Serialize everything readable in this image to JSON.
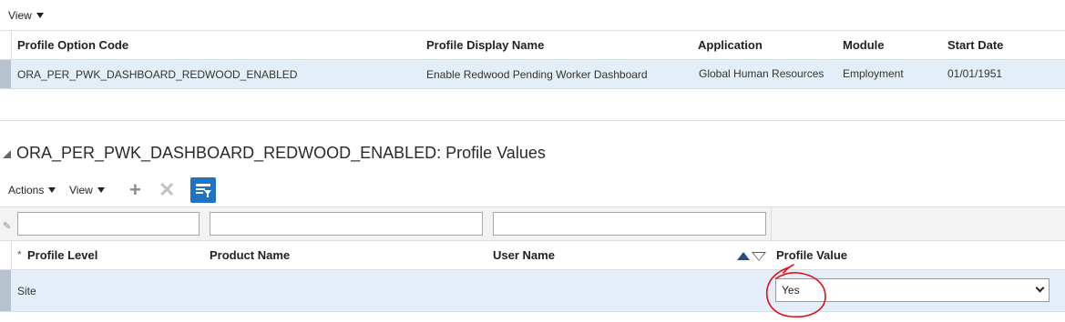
{
  "toolbar_top": {
    "view_label": "View"
  },
  "profile_options_table": {
    "columns": [
      "Profile Option Code",
      "Profile Display Name",
      "Application",
      "Module",
      "Start Date"
    ],
    "row": {
      "code": "ORA_PER_PWK_DASHBOARD_REDWOOD_ENABLED",
      "display_name": "Enable Redwood Pending Worker Dashboard",
      "application": "Global Human Resources",
      "module": "Employment",
      "start_date": "01/01/1951"
    }
  },
  "profile_values_section": {
    "title": "ORA_PER_PWK_DASHBOARD_REDWOOD_ENABLED: Profile Values",
    "toolbar": {
      "actions_label": "Actions",
      "view_label": "View",
      "add_icon": "plus-icon",
      "delete_icon": "close-icon",
      "filter_icon": "query-by-example-icon"
    },
    "filter_inputs": [
      {
        "value": ""
      },
      {
        "value": ""
      },
      {
        "value": ""
      }
    ],
    "columns": {
      "required_marker": "*",
      "profile_level": "Profile Level",
      "product_name": "Product Name",
      "user_name": "User Name",
      "profile_value": "Profile Value"
    },
    "row": {
      "profile_level": "Site",
      "product_name": "",
      "user_name": "",
      "profile_value": "Yes"
    }
  },
  "colors": {
    "selected_row": "#e4eef9",
    "accent_blue": "#1f73c2",
    "annotation_red": "#e0101a"
  }
}
